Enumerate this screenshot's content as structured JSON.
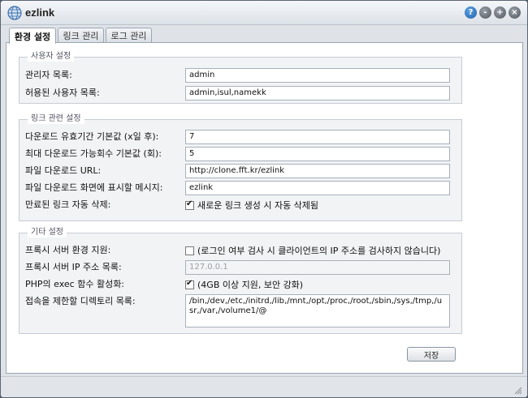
{
  "window": {
    "title": "ezlink",
    "buttons": {
      "help": "?",
      "minimize": "-",
      "maximize": "+",
      "close": "×"
    }
  },
  "tabs": [
    {
      "label": "환경 설정",
      "active": true
    },
    {
      "label": "링크 관리",
      "active": false
    },
    {
      "label": "로그 관리",
      "active": false
    }
  ],
  "user_settings": {
    "legend": "사용자 설정",
    "admin_list_label": "관리자 목록:",
    "admin_list_value": "admin",
    "allowed_users_label": "허용된 사용자 목록:",
    "allowed_users_value": "admin,isul,namekk"
  },
  "link_settings": {
    "legend": "링크 관련 설정",
    "expiry_label": "다운로드 유효기간 기본값 (x일 후):",
    "expiry_value": "7",
    "max_downloads_label": "최대 다운로드 가능회수 기본값 (회):",
    "max_downloads_value": "5",
    "download_url_label": "파일 다운로드 URL:",
    "download_url_value": "http://clone.fft.kr/ezlink",
    "download_message_label": "파일 다운로드 화면에 표시할 메시지:",
    "download_message_value": "ezlink",
    "auto_delete_label": "만료된 링크 자동 삭제:",
    "auto_delete_checked": true,
    "auto_delete_text": "새로운 링크 생성 시 자동 삭제됨"
  },
  "other_settings": {
    "legend": "기타 설정",
    "proxy_support_label": "프록시 서버 환경 지원:",
    "proxy_support_checked": false,
    "proxy_support_text": "(로그인 여부 검사 시 클라이언트의 IP 주소를 검사하지 않습니다)",
    "proxy_ip_label": "프록시 서버 IP 주소 목록:",
    "proxy_ip_value": "127.0.0.1",
    "php_exec_label": "PHP의 exec 함수 활성화:",
    "php_exec_checked": true,
    "php_exec_text": "(4GB 이상 지원, 보안 강화)",
    "restricted_dirs_label": "접속을 제한할 디렉토리 목록:",
    "restricted_dirs_value": "/bin,/dev,/etc,/initrd,/lib,/mnt,/opt,/proc,/root,/sbin,/sys,/tmp,/usr,/var,/volume1/@"
  },
  "actions": {
    "save_label": "저장"
  }
}
